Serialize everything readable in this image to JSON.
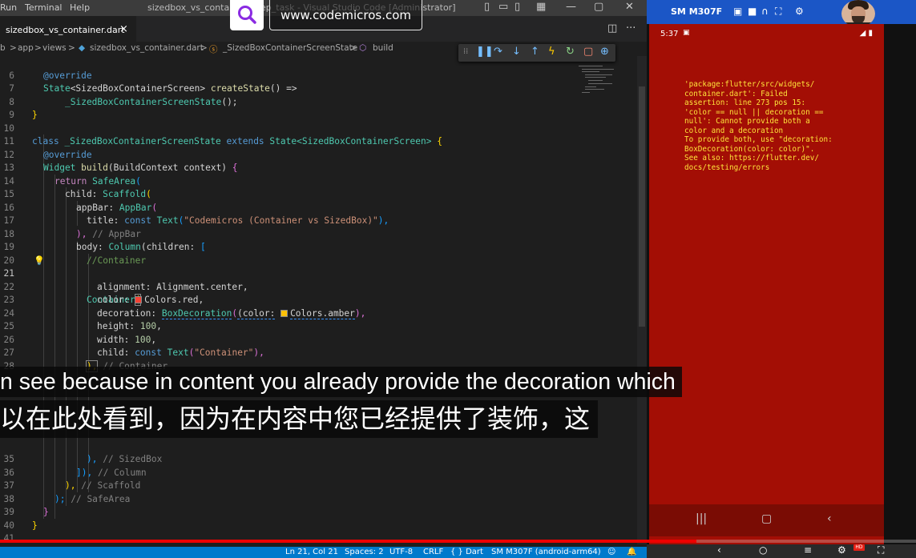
{
  "titlebar": {
    "menus": [
      "Run",
      "Terminal",
      "Help"
    ],
    "window_title": "sizedbox_vs_container  ...  ep_task - Visual Studio Code [Administrator]"
  },
  "tab": {
    "label": "sizedbox_vs_container.dart",
    "close": "×"
  },
  "breadcrumb": {
    "items": [
      "b",
      "app",
      "views",
      "sizedbox_vs_container.dart",
      "_SizedBoxContainerScreenState",
      "build"
    ],
    "sep": ">"
  },
  "overlay": {
    "url": "www.codemicros.com",
    "caption_en": "n see because in content you already provide the decoration which",
    "caption_zh": "以在此处看到，因为在内容中您已经提供了装饰，这",
    "progress": 0.76
  },
  "editor": {
    "current_line": "21",
    "lines": [
      {
        "n": "6"
      },
      {
        "n": "7"
      },
      {
        "n": "8"
      },
      {
        "n": "9"
      },
      {
        "n": "10"
      },
      {
        "n": "11"
      },
      {
        "n": "12"
      },
      {
        "n": "13"
      },
      {
        "n": "14"
      },
      {
        "n": "15"
      },
      {
        "n": "16"
      },
      {
        "n": "17"
      },
      {
        "n": "18"
      },
      {
        "n": "19"
      },
      {
        "n": "20"
      },
      {
        "n": "21"
      },
      {
        "n": "22"
      },
      {
        "n": "23"
      },
      {
        "n": "24"
      },
      {
        "n": "25"
      },
      {
        "n": "26"
      },
      {
        "n": "27"
      },
      {
        "n": "28"
      },
      {
        "n": "35"
      },
      {
        "n": "36"
      },
      {
        "n": "37"
      },
      {
        "n": "38"
      },
      {
        "n": "39"
      },
      {
        "n": "40"
      },
      {
        "n": "41"
      }
    ],
    "tokens": {
      "override": "@override",
      "state_ret": "State",
      "screen_type": "<SizedBoxContainerScreen>",
      "createState": "createState",
      "arrow": "() =>",
      "state_cls": "_SizedBoxContainerScreenState",
      "call_end": "();",
      "close_brace": "}",
      "class": "class",
      "extends": "extends",
      "state_generic": "State<SizedBoxContainerScreen>",
      "open_brace": "{",
      "widget": "Widget",
      "build": "build",
      "build_ctx": "(BuildContext context)",
      "return": "return",
      "safearea": "SafeArea",
      "paren": "(",
      "child": "child:",
      "scaffold": "Scaffold",
      "appbar_key": "appBar:",
      "appbar": "AppBar",
      "title_key": "title:",
      "const": "const",
      "text": "Text",
      "title_str": "\"Codemicros (Container vs SizedBox)\"",
      "paren_comma": "),",
      "cm_appbar": "// AppBar",
      "body_key": "body:",
      "column": "Column",
      "children": "(children:",
      "lbracket": "[",
      "cm_container": "//Container",
      "container": "Container",
      "alignment_key": "alignment:",
      "alignment_val": "Alignment.center,",
      "color_key": "color:",
      "colors_red": "Colors.red,",
      "decoration_key": "decoration:",
      "boxdecoration": "BoxDecoration",
      "bd_color": "(color:",
      "colors_amber": "Colors.amber",
      "height_key": "height:",
      "height_val": "100",
      "width_key": "width:",
      "width_val": "100",
      "container_str": "\"Container\"",
      "cm_container2": "// Container",
      "cm_sizedbox": "// SizedBox",
      "rbracket": "]),",
      "cm_column": "// Column",
      "cm_scaffold": "// Scaffold",
      "semi_paren": ");",
      "cm_safearea": "// SafeArea",
      "comma": ",",
      "space": " "
    },
    "swatch_red": "#f44336",
    "swatch_amber": "#ffc107"
  },
  "statusbar": {
    "position": "Ln 21, Col 21",
    "spaces": "Spaces: 2",
    "encoding": "UTF-8",
    "eol": "CRLF",
    "language": "{ } Dart",
    "device": "SM M307F (android-arm64)"
  },
  "device": {
    "name": "SM M307F",
    "time": "5:37",
    "background": "#a30e05",
    "error_text": "'package:flutter/src/widgets/\ncontainer.dart': Failed\nassertion: line 273 pos 15:\n'color == null || decoration ==\nnull': Cannot provide both a\ncolor and a decoration\nTo provide both, use \"decoration:\nBoxDecoration(color: color)\".\nSee also: https://flutter.dev/\ndocs/testing/errors",
    "hd_badge": "HD"
  },
  "icons": {
    "search": "search-icon",
    "debug": [
      "pause-icon",
      "step-over-icon",
      "step-into-icon",
      "step-out-icon",
      "hot-reload-icon",
      "restart-icon",
      "stop-icon",
      "devtools-icon"
    ]
  }
}
